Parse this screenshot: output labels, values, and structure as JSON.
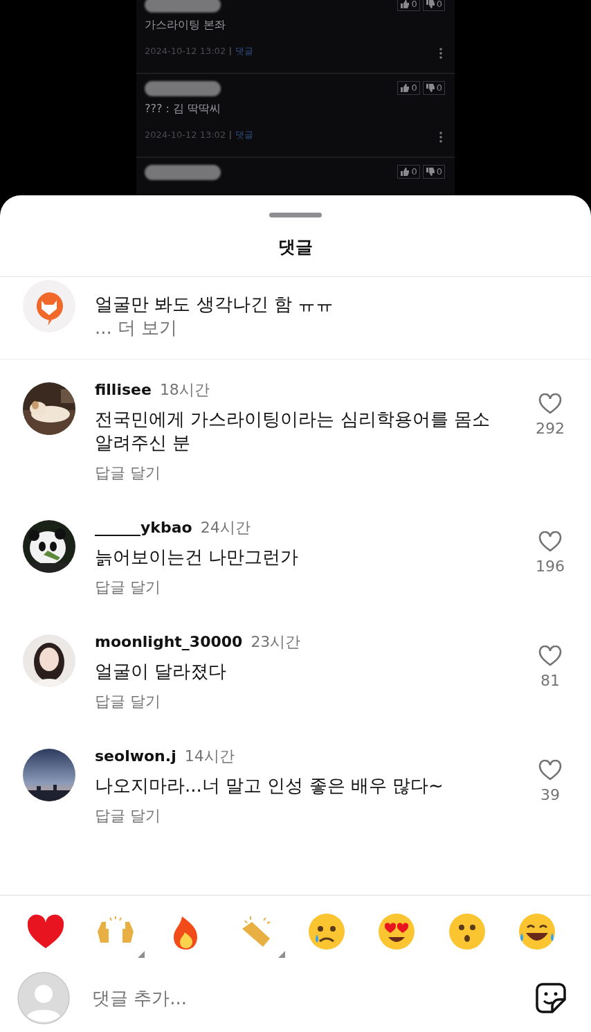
{
  "background_post": {
    "rows": [
      {
        "text": "가스라이팅 본좌",
        "date": "2024-10-12 13:02",
        "reply_label": "댓글",
        "up": "0",
        "down": "0"
      },
      {
        "text": "??? : 김 딱딱씨",
        "date": "2024-10-12 13:02",
        "reply_label": "댓글",
        "up": "0",
        "down": "0"
      },
      {
        "up": "0",
        "down": "0"
      }
    ]
  },
  "sheet": {
    "title": "댓글"
  },
  "comments": [
    {
      "kind": "brand",
      "text": "얼굴만 봐도 생각나긴 함 ㅠㅠ",
      "more": "... 더 보기"
    },
    {
      "kind": "user",
      "username": "fillisee",
      "time": "18시간",
      "text": "전국민에게 가스라이팅이라는 심리학용어를 몸소 알려주신 분",
      "reply": "답글 달기",
      "likes": "292",
      "liked": false
    },
    {
      "kind": "user",
      "username": "______ykbao",
      "time": "24시간",
      "text": "늙어보이는건 나만그런가",
      "reply": "답글 달기",
      "likes": "196",
      "liked": false
    },
    {
      "kind": "user",
      "username": "moonlight_30000",
      "time": "23시간",
      "text": "얼굴이 달라졌다",
      "reply": "답글 달기",
      "likes": "81",
      "liked": false
    },
    {
      "kind": "user",
      "username": "seolwon.j",
      "time": "14시간",
      "text": "나오지마라...너 말고 인성 좋은 배우 많다~",
      "reply": "답글 달기",
      "likes": "39",
      "liked": false
    }
  ],
  "reactions": [
    {
      "kind": "heart",
      "variants": false
    },
    {
      "kind": "raised-hands",
      "variants": true
    },
    {
      "kind": "fire",
      "variants": false
    },
    {
      "kind": "clap",
      "variants": true
    },
    {
      "kind": "crying",
      "variants": false
    },
    {
      "kind": "heart-eyes",
      "variants": false
    },
    {
      "kind": "surprised",
      "variants": false
    },
    {
      "kind": "laughing",
      "variants": false
    }
  ],
  "composer": {
    "placeholder": "댓글 추가..."
  }
}
